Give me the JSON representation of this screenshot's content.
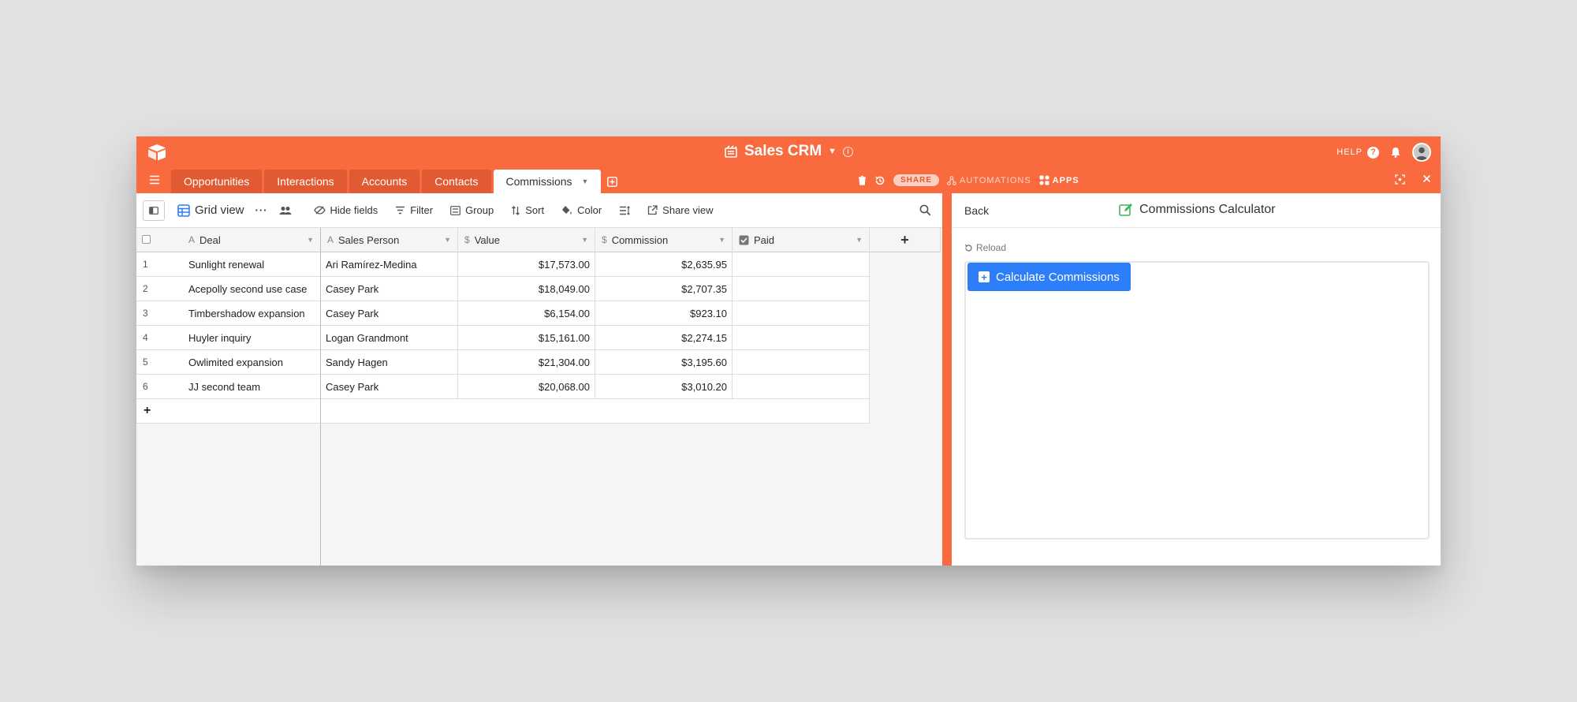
{
  "base": {
    "title": "Sales CRM"
  },
  "top_right": {
    "help": "HELP"
  },
  "tabs": [
    {
      "label": "Opportunities"
    },
    {
      "label": "Interactions"
    },
    {
      "label": "Accounts"
    },
    {
      "label": "Contacts"
    },
    {
      "label": "Commissions"
    }
  ],
  "tab_right": {
    "share": "SHARE",
    "automations": "AUTOMATIONS",
    "apps": "APPS"
  },
  "toolbar": {
    "view_name": "Grid view",
    "hide_fields": "Hide fields",
    "filter": "Filter",
    "group": "Group",
    "sort": "Sort",
    "color": "Color",
    "share_view": "Share view"
  },
  "columns": {
    "deal": "Deal",
    "sales_person": "Sales Person",
    "value": "Value",
    "commission": "Commission",
    "paid": "Paid"
  },
  "rows": [
    {
      "n": "1",
      "deal": "Sunlight renewal",
      "sales_person": "Ari Ramírez-Medina",
      "value": "$17,573.00",
      "commission": "$2,635.95"
    },
    {
      "n": "2",
      "deal": "Acepolly second use case",
      "sales_person": "Casey Park",
      "value": "$18,049.00",
      "commission": "$2,707.35"
    },
    {
      "n": "3",
      "deal": "Timbershadow expansion",
      "sales_person": "Casey Park",
      "value": "$6,154.00",
      "commission": "$923.10"
    },
    {
      "n": "4",
      "deal": "Huyler inquiry",
      "sales_person": "Logan Grandmont",
      "value": "$15,161.00",
      "commission": "$2,274.15"
    },
    {
      "n": "5",
      "deal": "Owlimited expansion",
      "sales_person": "Sandy Hagen",
      "value": "$21,304.00",
      "commission": "$3,195.60"
    },
    {
      "n": "6",
      "deal": "JJ second team",
      "sales_person": "Casey Park",
      "value": "$20,068.00",
      "commission": "$3,010.20"
    }
  ],
  "add_row": "+",
  "add_column": "+",
  "app": {
    "back": "Back",
    "title": "Commissions Calculator",
    "reload": "Reload",
    "button": "Calculate Commissions"
  },
  "colors": {
    "brand": "#f96b3f",
    "tab_inactive": "#e25a31",
    "accent": "#2d7ff9"
  }
}
